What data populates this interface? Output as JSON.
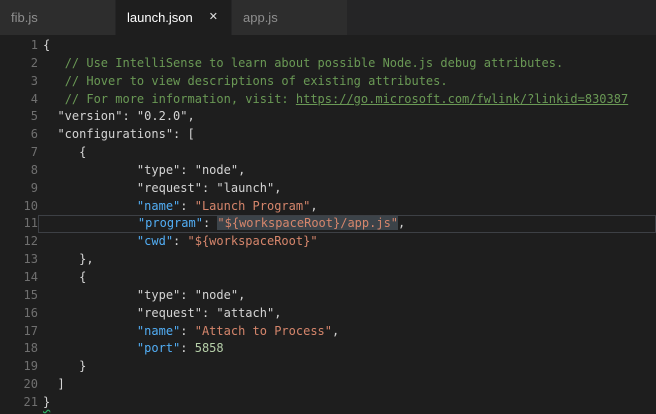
{
  "colors": {
    "bg": "#1e1e1e",
    "tabbar-bg": "#252526",
    "tab-inactive-bg": "#2d2d2d",
    "tab-active-bg": "#1e1e1e",
    "tab-inactive-fg": "#8f8f8f",
    "tab-active-fg": "#ffffff",
    "code-default": "#d4d4d4",
    "comment": "#6a9955",
    "key": "#52aef5",
    "string": "#d6866c",
    "number": "#b5cea8",
    "selection-bg": "#3c4349",
    "linenum": "#707070",
    "current-line-border": "#3d4045",
    "squiggle": "#2faf64"
  },
  "tabs": [
    {
      "label": "fib.js",
      "active": false
    },
    {
      "label": "launch.json",
      "active": true,
      "close_icon": "✕"
    },
    {
      "label": "app.js",
      "active": false
    }
  ],
  "editor": {
    "language": "json",
    "lines": [
      {
        "num": 1,
        "tokens": [
          {
            "t": "{",
            "c": "d"
          }
        ]
      },
      {
        "num": 2,
        "tokens": [
          {
            "t": "   ",
            "c": "d"
          },
          {
            "t": "// Use IntelliSense to learn about possible Node.js debug attributes.",
            "c": "c"
          }
        ]
      },
      {
        "num": 3,
        "tokens": [
          {
            "t": "   ",
            "c": "d"
          },
          {
            "t": "// Hover to view descriptions of existing attributes.",
            "c": "c"
          }
        ]
      },
      {
        "num": 4,
        "tokens": [
          {
            "t": "   ",
            "c": "d"
          },
          {
            "t": "// For more information, visit: ",
            "c": "c"
          },
          {
            "t": "https://go.microsoft.com/fwlink/?linkid=830387",
            "c": "lk"
          }
        ]
      },
      {
        "num": 5,
        "tokens": [
          {
            "t": "  \"version\": \"0.2.0\",",
            "c": "d"
          }
        ]
      },
      {
        "num": 6,
        "tokens": [
          {
            "t": "  \"configurations\": [",
            "c": "d"
          }
        ]
      },
      {
        "num": 7,
        "tokens": [
          {
            "t": "     {",
            "c": "d"
          }
        ]
      },
      {
        "num": 8,
        "tokens": [
          {
            "t": "             \"type\": \"node\",",
            "c": "d"
          }
        ]
      },
      {
        "num": 9,
        "tokens": [
          {
            "t": "             \"request\": \"launch\",",
            "c": "d"
          }
        ]
      },
      {
        "num": 10,
        "tokens": [
          {
            "t": "             ",
            "c": "d"
          },
          {
            "t": "\"name\"",
            "c": "k"
          },
          {
            "t": ": ",
            "c": "d"
          },
          {
            "t": "\"Launch Program\"",
            "c": "s"
          },
          {
            "t": ",",
            "c": "d"
          }
        ]
      },
      {
        "num": 11,
        "current": true,
        "tokens": [
          {
            "t": "             ",
            "c": "d"
          },
          {
            "t": "\"program\"",
            "c": "k"
          },
          {
            "t": ": ",
            "c": "d"
          },
          {
            "t": "\"${workspaceRoot}/app.js\"",
            "c": "ss"
          },
          {
            "t": ",",
            "c": "d"
          }
        ]
      },
      {
        "num": 12,
        "tokens": [
          {
            "t": "             ",
            "c": "d"
          },
          {
            "t": "\"cwd\"",
            "c": "k"
          },
          {
            "t": ": ",
            "c": "d"
          },
          {
            "t": "\"${workspaceRoot}\"",
            "c": "s"
          }
        ]
      },
      {
        "num": 13,
        "tokens": [
          {
            "t": "     },",
            "c": "d"
          }
        ]
      },
      {
        "num": 14,
        "tokens": [
          {
            "t": "     {",
            "c": "d"
          }
        ]
      },
      {
        "num": 15,
        "tokens": [
          {
            "t": "             \"type\": \"node\",",
            "c": "d"
          }
        ]
      },
      {
        "num": 16,
        "tokens": [
          {
            "t": "             \"request\": \"attach\",",
            "c": "d"
          }
        ]
      },
      {
        "num": 17,
        "tokens": [
          {
            "t": "             ",
            "c": "d"
          },
          {
            "t": "\"name\"",
            "c": "k"
          },
          {
            "t": ": ",
            "c": "d"
          },
          {
            "t": "\"Attach to Process\"",
            "c": "s"
          },
          {
            "t": ",",
            "c": "d"
          }
        ]
      },
      {
        "num": 18,
        "tokens": [
          {
            "t": "             ",
            "c": "d"
          },
          {
            "t": "\"port\"",
            "c": "k"
          },
          {
            "t": ": ",
            "c": "d"
          },
          {
            "t": "5858",
            "c": "n"
          }
        ]
      },
      {
        "num": 19,
        "tokens": [
          {
            "t": "     }",
            "c": "d"
          }
        ]
      },
      {
        "num": 20,
        "tokens": [
          {
            "t": "  ]",
            "c": "d"
          }
        ]
      },
      {
        "num": 21,
        "tokens": [
          {
            "t": "}",
            "c": "bw"
          }
        ]
      }
    ]
  }
}
